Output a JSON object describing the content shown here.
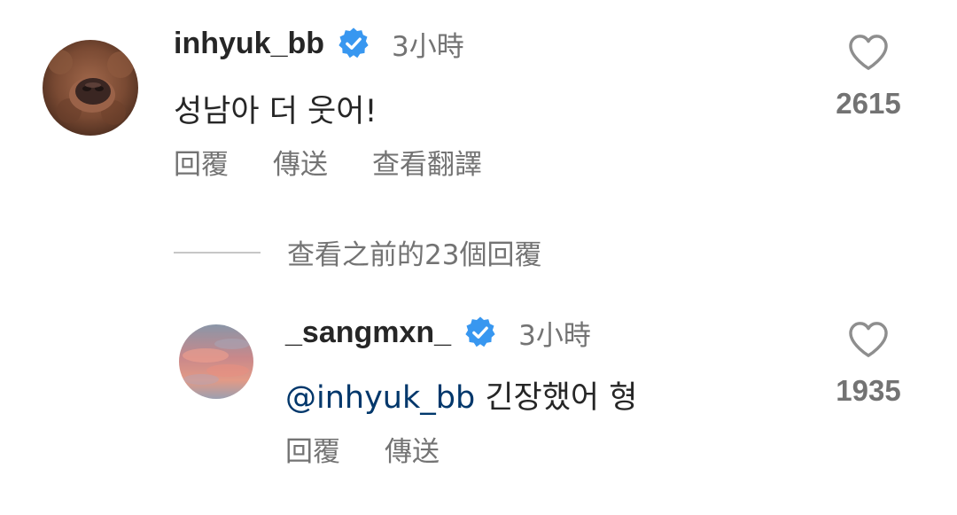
{
  "comments": [
    {
      "username": "inhyuk_bb",
      "verified": true,
      "time": "3小時",
      "text": "성남아 더 웃어!",
      "like_count": "2615",
      "actions": [
        "回覆",
        "傳送",
        "查看翻譯"
      ]
    }
  ],
  "view_replies_label": "查看之前的23個回覆",
  "reply": {
    "username": "_sangmxn_",
    "verified": true,
    "time": "3小時",
    "mention": "@inhyuk_bb",
    "text": " 긴장했어 형",
    "like_count": "1935",
    "actions": [
      "回覆",
      "傳送"
    ]
  },
  "colors": {
    "verified_badge": "#3897f0",
    "mention": "#00376b",
    "secondary_text": "#737373"
  },
  "icons": {
    "verified": "verified-badge-icon",
    "like": "heart-outline-icon"
  }
}
